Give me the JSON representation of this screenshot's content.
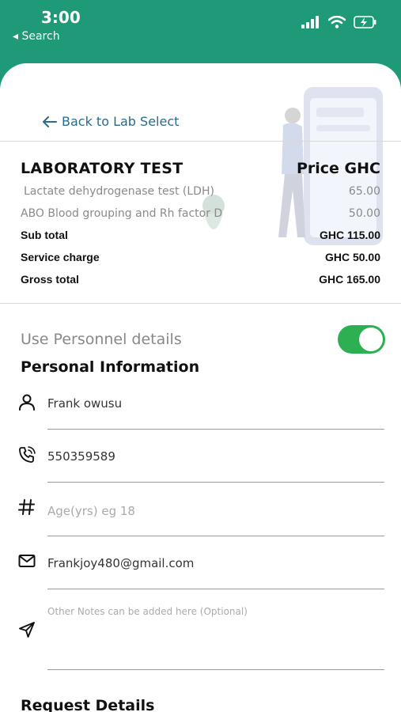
{
  "status_bar": {
    "time": "3:00",
    "back_app": "◂ Search"
  },
  "nav": {
    "back_label": "Back to Lab Select"
  },
  "lab": {
    "title": "LABORATORY TEST",
    "price_header": "Price GHC",
    "items": [
      {
        "name": "Lactate dehydrogenase test (LDH)",
        "price": "65.00"
      },
      {
        "name": "ABO Blood grouping and Rh factor D",
        "price": "50.00"
      }
    ],
    "subtotal_label": "Sub total",
    "subtotal_value": "GHC 115.00",
    "service_label": "Service charge",
    "service_value": "GHC 50.00",
    "gross_label": "Gross total",
    "gross_value": "GHC 165.00"
  },
  "personnel": {
    "toggle_label": "Use Personnel details",
    "toggle_on": true
  },
  "personal_info": {
    "title": "Personal Information",
    "name": "Frank owusu",
    "phone": "550359589",
    "age_placeholder": "Age(yrs) eg 18",
    "email": "Frankjoy480@gmail.com",
    "notes_placeholder": "Other Notes can be added here (Optional)"
  },
  "request": {
    "title": "Request Details"
  },
  "colors": {
    "brand_green": "#1f9a78",
    "toggle_green": "#2db052",
    "link_blue": "#2a6a8a"
  }
}
